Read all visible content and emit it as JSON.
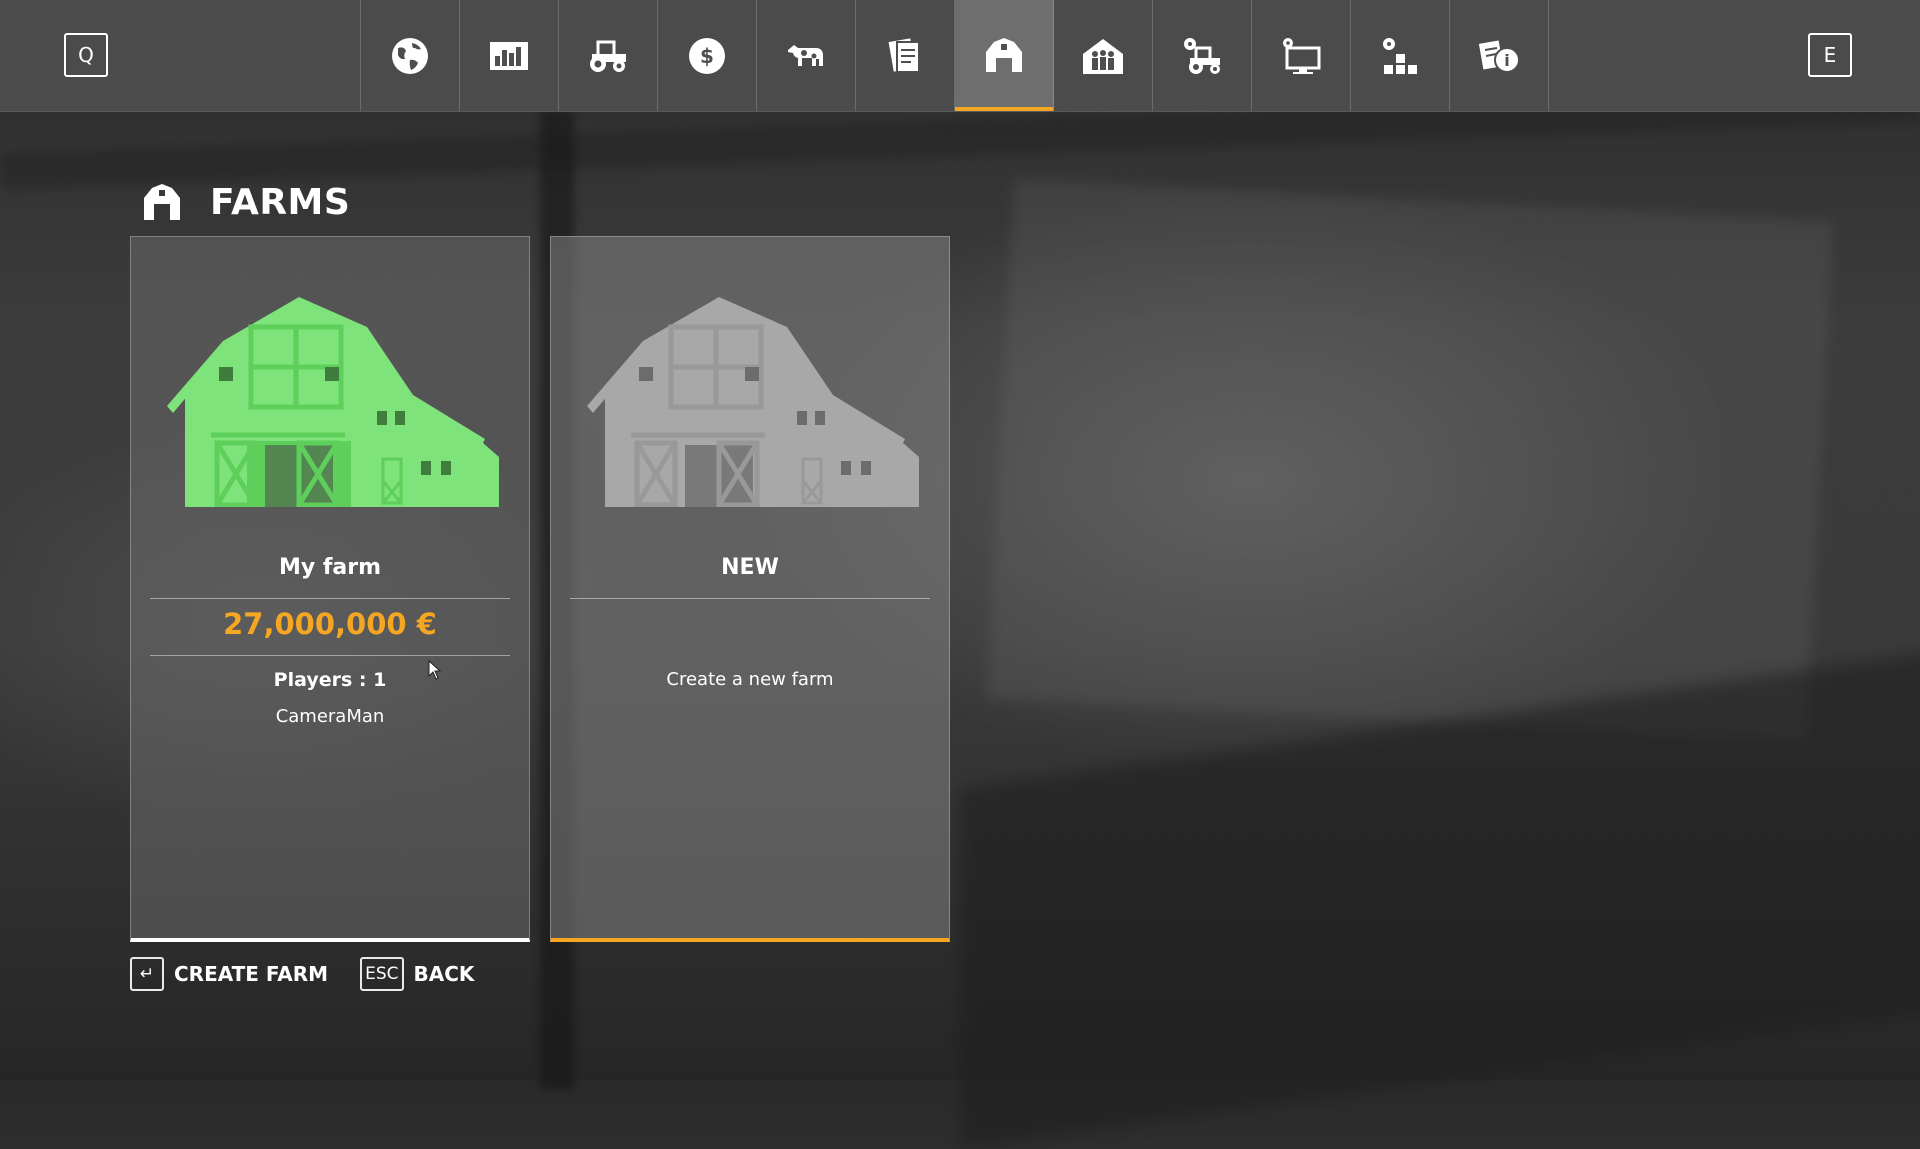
{
  "topbar": {
    "left_key": "Q",
    "right_key": "E",
    "tabs": [
      {
        "icon": "globe-icon",
        "active": false
      },
      {
        "icon": "statistics-chart-icon",
        "active": false
      },
      {
        "icon": "tractor-icon",
        "active": false
      },
      {
        "icon": "dollar-coin-icon",
        "active": false
      },
      {
        "icon": "cow-icon",
        "active": false
      },
      {
        "icon": "contracts-icon",
        "active": false
      },
      {
        "icon": "farm-barn-icon",
        "active": true
      },
      {
        "icon": "players-icon",
        "active": false
      },
      {
        "icon": "vehicle-settings-icon",
        "active": false
      },
      {
        "icon": "display-settings-icon",
        "active": false
      },
      {
        "icon": "game-settings-icon",
        "active": false
      },
      {
        "icon": "help-info-icon",
        "active": false
      }
    ]
  },
  "page": {
    "title": "FARMS",
    "title_icon": "farm-barn-icon"
  },
  "farms": [
    {
      "name": "My farm",
      "money": "27,000,000 €",
      "players_label": "Players : 1",
      "players": [
        "CameraMan"
      ],
      "color": "#7ee37a"
    },
    {
      "name": "NEW",
      "description": "Create a new farm",
      "color": "#a8a8a8"
    }
  ],
  "footer": {
    "create_key": "↵",
    "create_label": "CREATE FARM",
    "back_key": "ESC",
    "back_label": "BACK"
  },
  "colors": {
    "accent": "#f5a623",
    "money": "#f5a623",
    "farm_green": "#7ee37a"
  }
}
